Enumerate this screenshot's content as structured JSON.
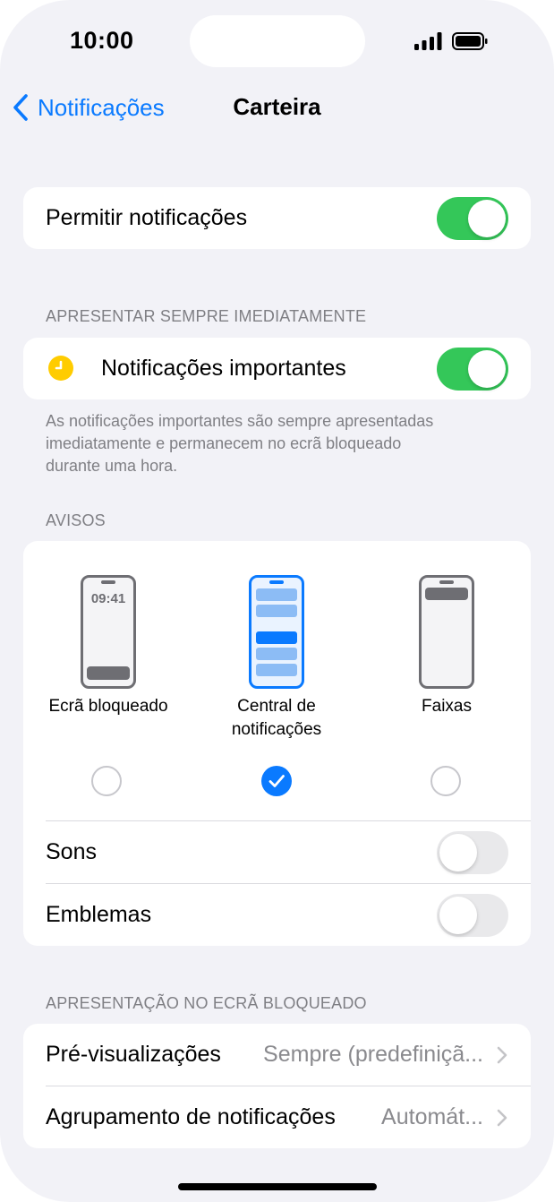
{
  "status_bar": {
    "time": "10:00"
  },
  "nav": {
    "back_label": "Notificações",
    "title": "Carteira"
  },
  "allow": {
    "label": "Permitir notificações",
    "enabled": true
  },
  "immediate": {
    "header": "APRESENTAR SEMPRE IMEDIATAMENTE",
    "label": "Notificações importantes",
    "enabled": true,
    "icon": "clock-icon",
    "icon_color": "#ffcc00",
    "footnote_lines": [
      "As notificações importantes são sempre apresentadas",
      "imediatamente e permanecem no ecrã bloqueado",
      "durante uma hora."
    ]
  },
  "alerts": {
    "header": "AVISOS",
    "options": [
      {
        "label_lines": [
          "Ecrã bloqueado"
        ],
        "selected": false,
        "preview_time": "09:41"
      },
      {
        "label_lines": [
          "Central de",
          "notificações"
        ],
        "selected": true
      },
      {
        "label_lines": [
          "Faixas"
        ],
        "selected": false
      }
    ],
    "sounds": {
      "label": "Sons",
      "enabled": false
    },
    "badges": {
      "label": "Emblemas",
      "enabled": false
    }
  },
  "lock_screen": {
    "header": "APRESENTAÇÃO NO ECRÃ BLOQUEADO",
    "previews": {
      "label": "Pré-visualizações",
      "value": "Sempre (predefiniçã..."
    },
    "grouping": {
      "label": "Agrupamento de notificações",
      "value": "Automát..."
    }
  },
  "colors": {
    "accent": "#0a7aff",
    "toggle_on": "#34c759",
    "toggle_off": "#e9e9eb",
    "background": "#f2f2f7"
  }
}
